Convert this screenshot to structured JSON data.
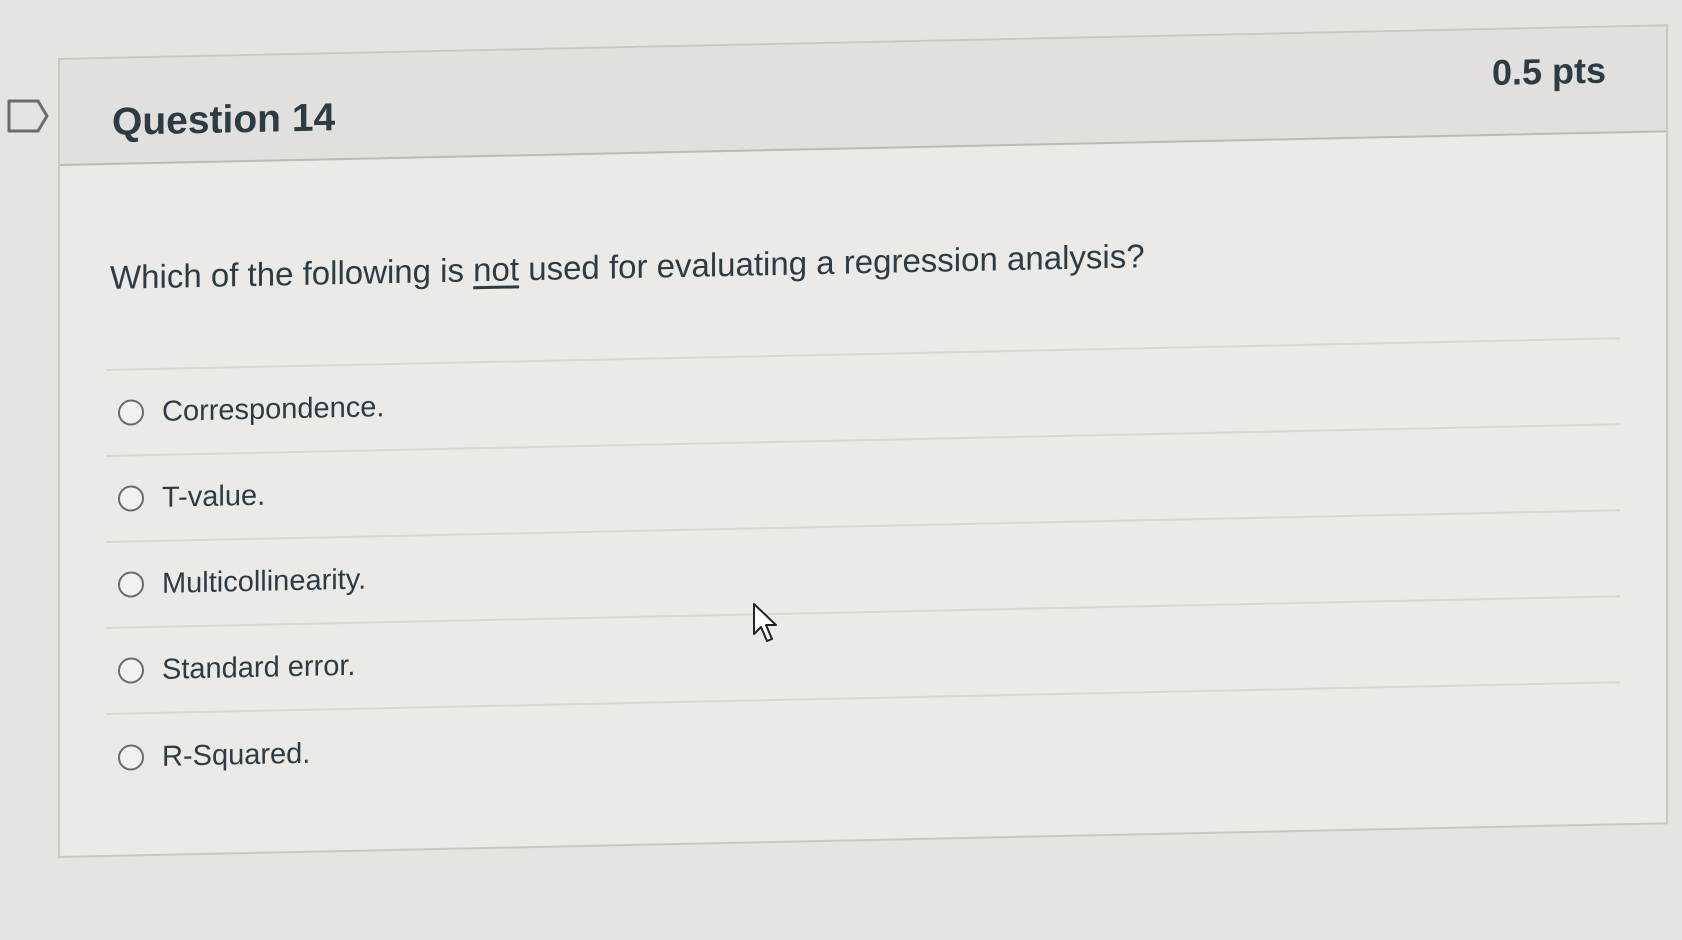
{
  "question": {
    "title": "Question 14",
    "points": "0.5 pts",
    "text_before": "Which of the following is ",
    "text_emphasis": "not",
    "text_after": " used for evaluating a regression analysis?"
  },
  "answers": [
    {
      "label": "Correspondence."
    },
    {
      "label": "T-value."
    },
    {
      "label": "Multicollinearity."
    },
    {
      "label": "Standard error."
    },
    {
      "label": "R-Squared."
    }
  ],
  "icons": {
    "flag": "bookmark-flag-icon",
    "cursor": "mouse-pointer-icon",
    "radio": "radio-button-icon"
  },
  "colors": {
    "text": "#2d3b45",
    "background": "#e6e4e0",
    "card": "#ebeae6",
    "header": "#e1e0dc"
  }
}
